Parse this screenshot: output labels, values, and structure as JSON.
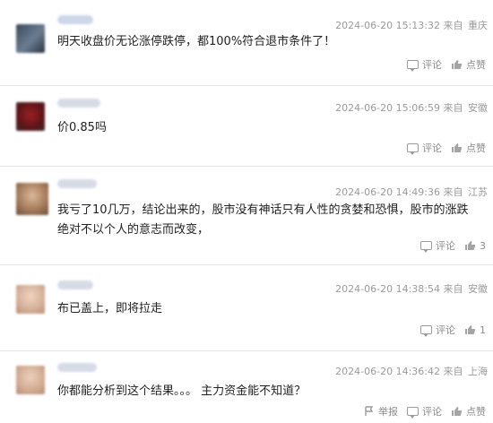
{
  "comments": [
    {
      "timestamp": "2024-06-20 15:13:32",
      "source_label": "来自",
      "location": "重庆",
      "text": "明天收盘价无论涨停跌停，都100%符合退市条件了！",
      "actions": {
        "comment": "评论",
        "like": "点赞"
      }
    },
    {
      "timestamp": "2024-06-20 15:06:59",
      "source_label": "来自",
      "location": "安徽",
      "text": "价0.85吗",
      "actions": {
        "comment": "评论",
        "like": "点赞"
      }
    },
    {
      "timestamp": "2024-06-20 14:49:36",
      "source_label": "来自",
      "location": "江苏",
      "text": "我亏了10几万，结论出来的，股市没有神话只有人性的贪婪和恐惧，股市的涨跌绝对不以个人的意志而改变，",
      "actions": {
        "comment": "评论",
        "like": "3"
      }
    },
    {
      "timestamp": "2024-06-20 14:38:54",
      "source_label": "来自",
      "location": "安徽",
      "text": "布已盖上，即将拉走",
      "actions": {
        "comment": "评论",
        "like": "1"
      }
    },
    {
      "timestamp": "2024-06-20 14:36:42",
      "source_label": "来自",
      "location": "上海",
      "text": "你都能分析到这个结果。。。 主力资金能不知道？",
      "actions": {
        "report": "举报",
        "comment": "评论",
        "like": "点赞"
      }
    }
  ],
  "colors": {
    "text": "#222222",
    "meta": "#9a9a9a",
    "divider": "#e4e4e4",
    "name_blur": "#cdd6e8"
  },
  "icons": {
    "comment": "comment-bubble-icon",
    "like": "thumbs-up-icon",
    "report": "report-flag-icon"
  }
}
